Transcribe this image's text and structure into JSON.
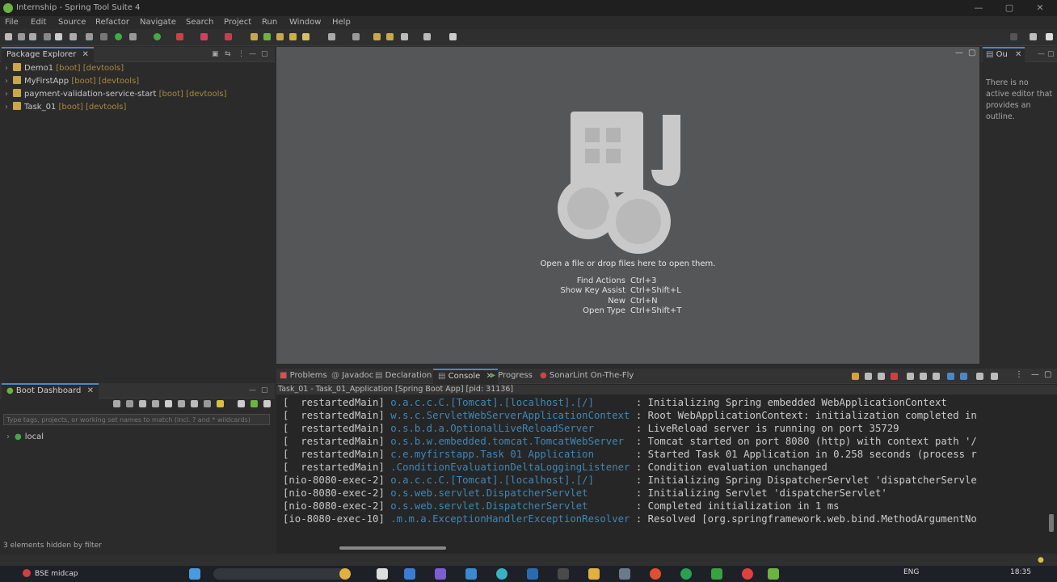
{
  "window": {
    "title": "Internship - Spring Tool Suite 4",
    "controls": [
      "—",
      "▢",
      "✕"
    ]
  },
  "menu": [
    "File",
    "Edit",
    "Source",
    "Refactor",
    "Navigate",
    "Search",
    "Project",
    "Run",
    "Window",
    "Help"
  ],
  "package_explorer": {
    "tab_label": "Package Explorer",
    "projects": [
      {
        "name": "Demo1",
        "deco": "[boot] [devtools]"
      },
      {
        "name": "MyFirstApp",
        "deco": "[boot] [devtools]"
      },
      {
        "name": "payment-validation-service-start",
        "deco": "[boot] [devtools]"
      },
      {
        "name": "Task_01",
        "deco": "[boot] [devtools]"
      }
    ]
  },
  "editor": {
    "open_hint": "Open a file or drop files here to open them.",
    "shortcuts": [
      {
        "label": "Find Actions",
        "keys": "Ctrl+3"
      },
      {
        "label": "Show Key Assist",
        "keys": "Ctrl+Shift+L"
      },
      {
        "label": "New",
        "keys": "Ctrl+N"
      },
      {
        "label": "Open Type",
        "keys": "Ctrl+Shift+T"
      }
    ]
  },
  "outline": {
    "tab_label": "Ou",
    "message": "There is no active editor that provides an outline."
  },
  "bottom_tabs": [
    "Problems",
    "Javadoc",
    "Declaration",
    "Console",
    "Progress",
    "SonarLint On-The-Fly"
  ],
  "bottom_active_tab": "Console",
  "console": {
    "process_label": "Task_01 - Task_01_Application [Spring Boot App] [pid: 31136]",
    "lines": [
      {
        "thread": "[  restartedMain]",
        "logger": "o.a.c.c.C.[Tomcat].[localhost].[/]      ",
        "msg": ": Initializing Spring embedded WebApplicationContext"
      },
      {
        "thread": "[  restartedMain]",
        "logger": "w.s.c.ServletWebServerApplicationContext",
        "msg": ": Root WebApplicationContext: initialization completed in"
      },
      {
        "thread": "[  restartedMain]",
        "logger": "o.s.b.d.a.OptionalLiveReloadServer      ",
        "msg": ": LiveReload server is running on port 35729"
      },
      {
        "thread": "[  restartedMain]",
        "logger": "o.s.b.w.embedded.tomcat.TomcatWebServer ",
        "msg": ": Tomcat started on port 8080 (http) with context path '/"
      },
      {
        "thread": "[  restartedMain]",
        "logger": "c.e.myfirstapp.Task 01 Application      ",
        "msg": ": Started Task 01 Application in 0.258 seconds (process r"
      },
      {
        "thread": "[  restartedMain]",
        "logger": ".ConditionEvaluationDeltaLoggingListener",
        "msg": ": Condition evaluation unchanged"
      },
      {
        "thread": "[nio-8080-exec-2]",
        "logger": "o.a.c.c.C.[Tomcat].[localhost].[/]      ",
        "msg": ": Initializing Spring DispatcherServlet 'dispatcherServle"
      },
      {
        "thread": "[nio-8080-exec-2]",
        "logger": "o.s.web.servlet.DispatcherServlet       ",
        "msg": ": Initializing Servlet 'dispatcherServlet'"
      },
      {
        "thread": "[nio-8080-exec-2]",
        "logger": "o.s.web.servlet.DispatcherServlet       ",
        "msg": ": Completed initialization in 1 ms"
      },
      {
        "thread": "[io-8080-exec-10]",
        "logger": ".m.m.a.ExceptionHandlerExceptionResolver",
        "msg": ": Resolved [org.springframework.web.bind.MethodArgumentNo"
      }
    ]
  },
  "boot_dashboard": {
    "tab_label": "Boot Dashboard",
    "filter_placeholder": "Type tags, projects, or working set names to match (incl. ? and * wildcards)",
    "items": [
      {
        "name": "local"
      }
    ],
    "status": "3 elements hidden by filter"
  },
  "taskbar": {
    "notification": "BSE midcap",
    "language": "ENG",
    "time": "18:35"
  },
  "colors": {
    "accent": "#4a88c7",
    "spring_green": "#6db33f",
    "console_logger": "#3f87b7",
    "decoration": "#a88a3c"
  }
}
